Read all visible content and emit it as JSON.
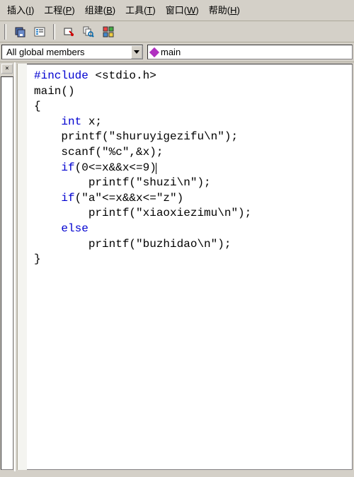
{
  "menu": {
    "insert": "插入",
    "project": "工程",
    "build": "组建",
    "tools": "工具",
    "window": "窗口",
    "help": "帮助",
    "insert_k": "I",
    "project_k": "P",
    "build_k": "B",
    "tools_k": "T",
    "window_k": "W",
    "help_k": "H"
  },
  "combo": {
    "scope": "All global members",
    "func": "main"
  },
  "side": {
    "close": "×"
  },
  "code": {
    "l1_pp": "#include",
    "l1_inc": " <stdio.h>",
    "l2": "main()",
    "l3": "{",
    "l4_kw": "int",
    "l4_rest": " x;",
    "l5": "    printf(\"shuruyigezifu\\n\");",
    "l6": "    scanf(\"%c\",&x);",
    "l7_kw": "if",
    "l7_rest": "(0<=x&&x<=9)",
    "l8": "        printf(\"shuzi\\n\");",
    "l9_kw": "if",
    "l9_rest": "(\"a\"<=x&&x<=\"z\")",
    "l10": "        printf(\"xiaoxiezimu\\n\");",
    "l11_kw": "else",
    "l12": "        printf(\"buzhidao\\n\");",
    "l13": "}"
  }
}
